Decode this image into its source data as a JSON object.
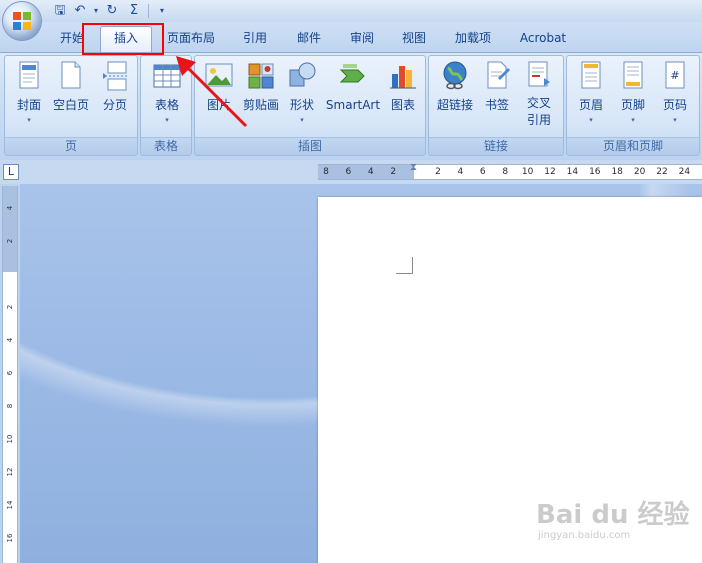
{
  "tabs": [
    {
      "label": "开始",
      "active": false
    },
    {
      "label": "插入",
      "active": true
    },
    {
      "label": "页面布局",
      "active": false
    },
    {
      "label": "引用",
      "active": false
    },
    {
      "label": "邮件",
      "active": false
    },
    {
      "label": "审阅",
      "active": false
    },
    {
      "label": "视图",
      "active": false
    },
    {
      "label": "加载项",
      "active": false
    },
    {
      "label": "Acrobat",
      "active": false
    }
  ],
  "groups": {
    "pages": {
      "label": "页",
      "buttons": [
        {
          "label": "封面",
          "icon": "cover-page-icon",
          "has_dropdown": true
        },
        {
          "label": "空白页",
          "icon": "blank-page-icon"
        },
        {
          "label": "分页",
          "icon": "page-break-icon"
        }
      ]
    },
    "tables": {
      "label": "表格",
      "buttons": [
        {
          "label": "表格",
          "icon": "table-icon",
          "has_dropdown": true
        }
      ]
    },
    "illustrations": {
      "label": "插图",
      "buttons": [
        {
          "label": "图片",
          "icon": "picture-icon"
        },
        {
          "label": "剪贴画",
          "icon": "clip-art-icon"
        },
        {
          "label": "形状",
          "icon": "shapes-icon",
          "has_dropdown": true
        },
        {
          "label": "SmartArt",
          "icon": "smartart-icon"
        },
        {
          "label": "图表",
          "icon": "chart-icon"
        }
      ]
    },
    "links": {
      "label": "链接",
      "buttons": [
        {
          "label": "超链接",
          "icon": "hyperlink-icon"
        },
        {
          "label": "书签",
          "icon": "bookmark-icon"
        },
        {
          "label": "交叉\n引用",
          "line1": "交叉",
          "line2": "引用",
          "icon": "cross-reference-icon"
        }
      ]
    },
    "header_footer": {
      "label": "页眉和页脚",
      "buttons": [
        {
          "label": "页眉",
          "icon": "header-icon",
          "has_dropdown": true
        },
        {
          "label": "页脚",
          "icon": "footer-icon",
          "has_dropdown": true
        },
        {
          "label": "页码",
          "icon": "page-number-icon",
          "has_dropdown": true
        }
      ]
    }
  },
  "quick_access": [
    "save-icon",
    "undo-icon",
    "redo-icon",
    "sigma-icon",
    "customize-icon"
  ],
  "ruler": {
    "tab_selector": "L",
    "h_labels": [
      "8",
      "6",
      "4",
      "2",
      "",
      "2",
      "4",
      "6",
      "8",
      "10",
      "12",
      "14",
      "16",
      "18",
      "20",
      "22",
      "24"
    ],
    "v_labels": [
      "4",
      "2",
      "",
      "2",
      "4",
      "6",
      "8",
      "10",
      "12",
      "14",
      "16"
    ]
  },
  "annotation": {
    "highlight_color": "#ff0000",
    "arrow_color": "#e8141a"
  },
  "watermark": {
    "brand": "Bai du 经验",
    "url": "jingyan.baidu.com"
  },
  "colors": {
    "ribbon_text": "#15428b",
    "accent": "#3e6aaa"
  }
}
